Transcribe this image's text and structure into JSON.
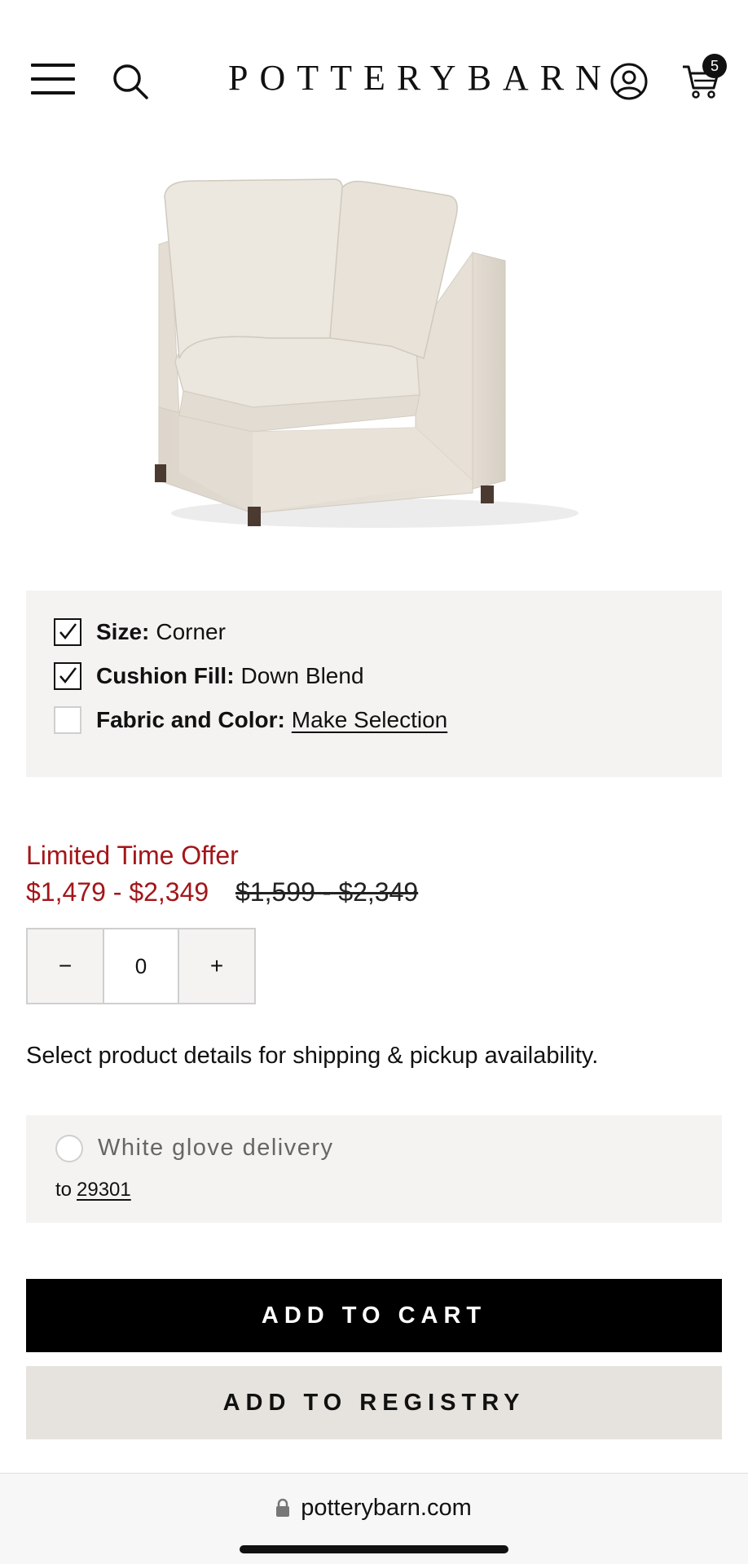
{
  "header": {
    "logo": "POTTERYBARN",
    "cart_count": "5",
    "icons": [
      "menu-icon",
      "search-icon",
      "account-icon",
      "cart-icon"
    ]
  },
  "product": {
    "image": "sectional-corner-sofa"
  },
  "options": [
    {
      "key": "Size:",
      "value": "Corner",
      "checked": true
    },
    {
      "key": "Cushion Fill:",
      "value": "Down Blend",
      "checked": true
    },
    {
      "key": "Fabric and Color:",
      "value": "Make Selection",
      "checked": false
    }
  ],
  "pricing": {
    "offer_label": "Limited Time Offer",
    "sale_price": "$1,479 - $2,349",
    "original_price": "$1,599 - $2,349"
  },
  "quantity": {
    "decrement": "−",
    "value": "0",
    "increment": "+"
  },
  "shipping_note": "Select product details for shipping & pickup availability.",
  "delivery": {
    "option_label": "White glove delivery",
    "to_label": "to",
    "zip": "29301"
  },
  "actions": {
    "add_to_cart": "ADD TO CART",
    "add_to_registry": "ADD TO REGISTRY"
  },
  "browser": {
    "url": "potterybarn.com"
  },
  "colors": {
    "sale_red": "#a3161a",
    "panel_bg": "#f4f3f1",
    "registry_bg": "#e6e3de"
  }
}
